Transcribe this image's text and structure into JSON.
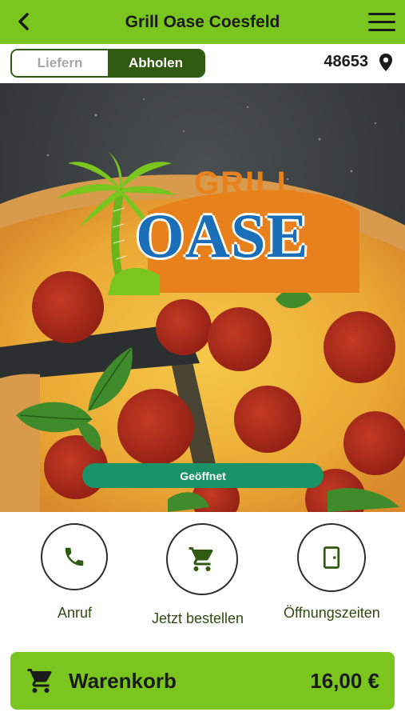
{
  "header": {
    "title": "Grill Oase Coesfeld"
  },
  "mode_toggle": {
    "options": [
      {
        "label": "Liefern",
        "selected": false
      },
      {
        "label": "Abholen",
        "selected": true
      }
    ]
  },
  "location": {
    "zip": "48653"
  },
  "logo": {
    "text_top": "GRILL",
    "text_main": "OASE"
  },
  "status": {
    "label": "Geöffnet"
  },
  "actions": [
    {
      "label": "Anruf",
      "icon": "phone-icon"
    },
    {
      "label": "Jetzt bestellen",
      "icon": "cart-icon"
    },
    {
      "label": "Öffnungszeiten",
      "icon": "door-icon"
    }
  ],
  "cart": {
    "label": "Warenkorb",
    "total": "16,00 €"
  },
  "colors": {
    "brand_green": "#7ac61e",
    "dark_green": "#2f5a0f",
    "status_green": "#199367",
    "logo_orange": "#e8811c",
    "logo_blue": "#1b6fb8"
  }
}
